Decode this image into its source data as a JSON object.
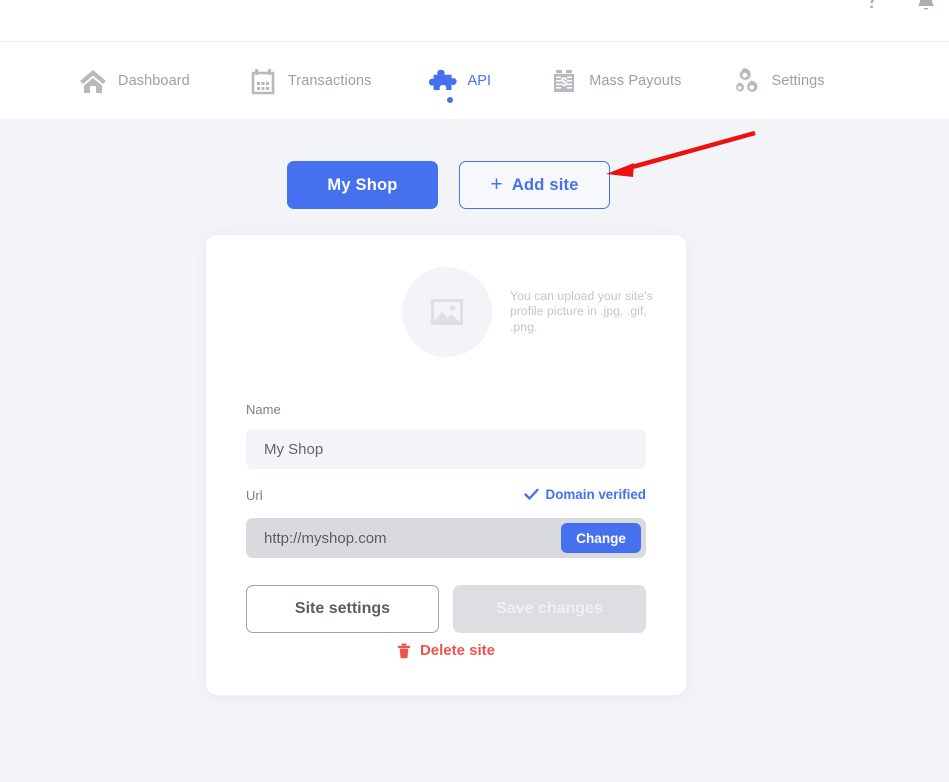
{
  "topbar": {
    "help_icon": "question-mark-icon",
    "notifications_icon": "bell-icon"
  },
  "nav": {
    "items": [
      {
        "id": "dashboard",
        "label": "Dashboard",
        "icon": "home-icon",
        "active": false
      },
      {
        "id": "transactions",
        "label": "Transactions",
        "icon": "calendar-icon",
        "active": false
      },
      {
        "id": "api",
        "label": "API",
        "icon": "puzzle-icon",
        "active": true
      },
      {
        "id": "payouts",
        "label": "Mass Payouts",
        "icon": "banknotes-icon",
        "active": false
      },
      {
        "id": "settings",
        "label": "Settings",
        "icon": "gears-icon",
        "active": false
      }
    ]
  },
  "site_tabs": {
    "my_shop_label": "My Shop",
    "add_site_label": "Add site",
    "add_site_plus": "+"
  },
  "card": {
    "upload_hint": "You can upload your site's profile picture in .jpg, .gif, .png.",
    "avatar_icon": "image-placeholder-icon",
    "name_label": "Name",
    "name_value": "My Shop",
    "name_placeholder": "My Shop",
    "url_label": "Url",
    "url_value": "http://myshop.com",
    "url_placeholder": "http://myshop.com",
    "verified_label": "Domain verified",
    "verified_icon": "check-icon",
    "change_label": "Change",
    "site_settings_label": "Site settings",
    "save_changes_label": "Save changes",
    "delete_label": "Delete site",
    "delete_icon": "trash-icon"
  },
  "annotation": {
    "arrow_color": "#ee1111",
    "target": "add-site-button"
  },
  "colors": {
    "accent_blue": "#4571ee",
    "page_bg": "#f3f4f8",
    "danger_red": "#ef5350",
    "muted_text": "#9b9fa6"
  }
}
